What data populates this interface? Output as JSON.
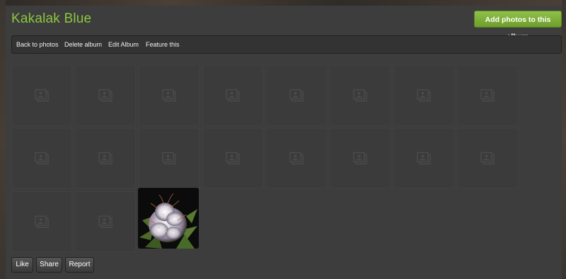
{
  "album": {
    "title": "Kakalak Blue",
    "add_photos_label": "Add photos to this album"
  },
  "toolbar": {
    "items": [
      {
        "label": "Back to photos"
      },
      {
        "label": "Delete album"
      },
      {
        "label": "Edit Album"
      },
      {
        "label": "Feature this"
      }
    ]
  },
  "grid": {
    "placeholder_icon": "photo-placeholder-icon",
    "photo_tile": {
      "icon": "plant-photo"
    }
  },
  "actions": {
    "like_label": "Like",
    "share_label": "Share",
    "report_label": "Report"
  },
  "colors": {
    "title": "#8dc63f",
    "accent_button": "#7aad35",
    "background": "#3d3d3d"
  }
}
